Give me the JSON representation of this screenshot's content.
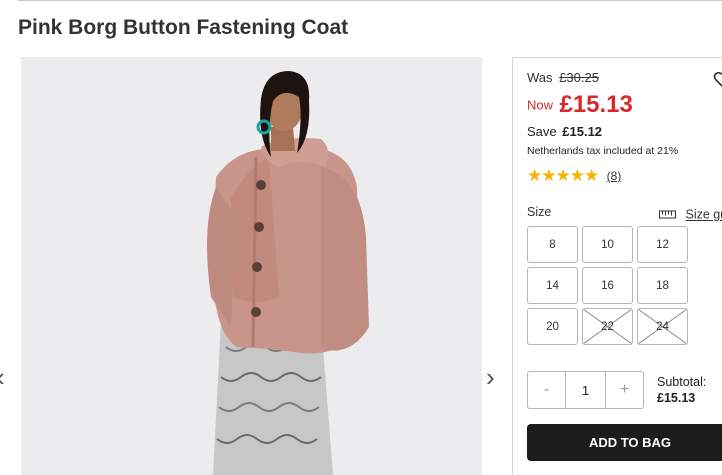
{
  "product": {
    "title": "Pink Borg Button Fastening Coat",
    "image_alt": "Model wearing pink borg button fastening coat over a snake print dress"
  },
  "gallery": {
    "prev_icon": "‹",
    "next_icon": "›"
  },
  "pricing": {
    "was_label": "Was",
    "was_price": "£30.25",
    "now_label": "Now",
    "now_price": "£15.13",
    "save_label": "Save",
    "save_amount": "£15.12",
    "tax_note": "Netherlands tax included at 21%",
    "now_color": "#d52b2b"
  },
  "rating": {
    "stars": 5,
    "review_count": "(8)",
    "star_color": "#f4b400"
  },
  "sizes": {
    "label": "Size",
    "guide_label": "Size gu",
    "options": [
      {
        "label": "8",
        "available": true
      },
      {
        "label": "10",
        "available": true
      },
      {
        "label": "12",
        "available": true
      },
      {
        "label": "14",
        "available": true
      },
      {
        "label": "16",
        "available": true
      },
      {
        "label": "18",
        "available": true
      },
      {
        "label": "20",
        "available": true
      },
      {
        "label": "22",
        "available": false
      },
      {
        "label": "24",
        "available": false
      }
    ]
  },
  "quantity": {
    "minus": "-",
    "value": "1",
    "plus": "+"
  },
  "subtotal": {
    "label": "Subtotal:",
    "amount": "£15.13"
  },
  "actions": {
    "add_to_bag": "ADD TO BAG"
  },
  "icons": {
    "wishlist": "heart-icon",
    "size_guide": "ruler-icon",
    "prev": "chevron-left-icon",
    "next": "chevron-right-icon"
  }
}
